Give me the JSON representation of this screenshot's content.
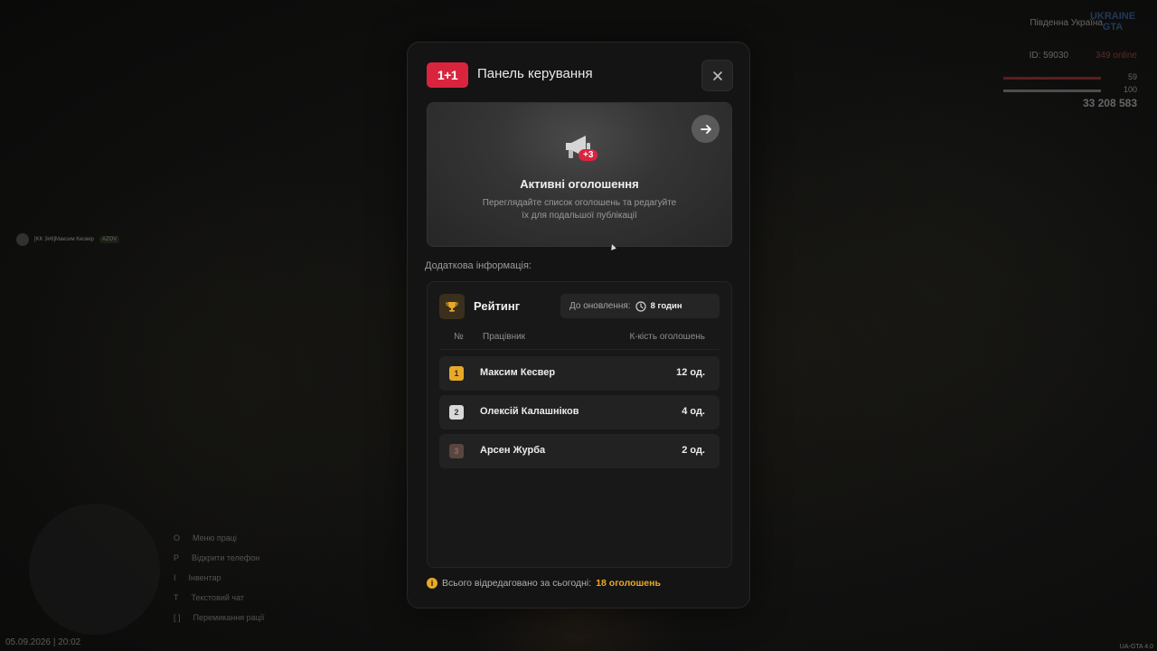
{
  "hud": {
    "region": "Південна Україна",
    "server_logo": "UKRAINE GTA",
    "player_id": "ID: 59030",
    "online": "349 online",
    "health": "59",
    "armor": "100",
    "money": "33 208 583"
  },
  "player_tag": {
    "name": "[KK 3#6]Максим Кесвер",
    "badge": "AZOV"
  },
  "hints": [
    {
      "key": "O",
      "label": "Меню праці"
    },
    {
      "key": "P",
      "label": "Відкрити телефон"
    },
    {
      "key": "I",
      "label": "Інвентар"
    },
    {
      "key": "T",
      "label": "Текстовий чат"
    },
    {
      "key": "[ ]",
      "label": "Перемикання рації"
    }
  ],
  "datetime": "05.09.2026 | 20:02",
  "version": "UA-GTA 4.0",
  "modal": {
    "logo_text": "1+1",
    "title": "Панель керування",
    "banner": {
      "badge": "+3",
      "title": "Активні оголошення",
      "description": "Переглядайте список оголошень та редагуйте їх для подальшої публікації"
    },
    "section_label": "Додаткова інформація:",
    "rating": {
      "title": "Рейтинг",
      "update_label": "До оновлення:",
      "update_value": "8 годин",
      "columns": {
        "num": "№",
        "worker": "Працівник",
        "count": "К-кість оголошень"
      },
      "rows": [
        {
          "rank": "1",
          "name": "Максим Кесвер",
          "count": "12 од."
        },
        {
          "rank": "2",
          "name": "Олексій Калашніков",
          "count": "4 од."
        },
        {
          "rank": "3",
          "name": "Арсен Журба",
          "count": "2 од."
        }
      ]
    },
    "footer": {
      "label": "Всього відредаговано за сьогодні:",
      "value": "18 оголошень"
    }
  }
}
